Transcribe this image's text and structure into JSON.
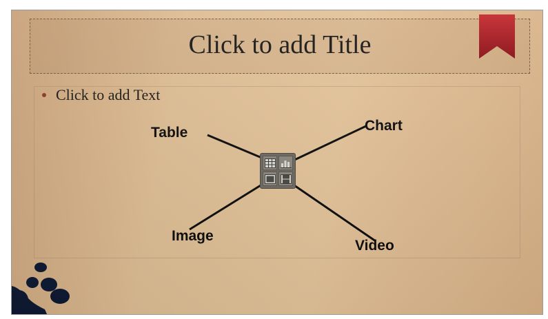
{
  "slide": {
    "title_placeholder": "Click to add Title",
    "text_placeholder": "Click to add Text"
  },
  "insert_panel": {
    "buttons": [
      {
        "name": "table",
        "icon": "table-icon"
      },
      {
        "name": "chart",
        "icon": "chart-icon"
      },
      {
        "name": "image",
        "icon": "image-icon"
      },
      {
        "name": "video",
        "icon": "video-icon"
      }
    ]
  },
  "annotations": {
    "table": "Table",
    "chart": "Chart",
    "image": "Image",
    "video": "Video"
  },
  "colors": {
    "ribbon": "#b3262b",
    "background": "#ddbd94",
    "decor": "#0e1a33"
  }
}
